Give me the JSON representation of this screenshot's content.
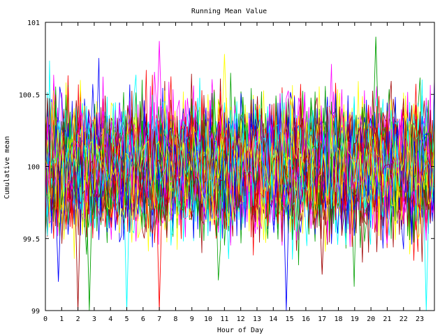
{
  "chart_data": {
    "type": "line",
    "title": "Running Mean Value",
    "xlabel": "Hour of Day",
    "ylabel": "Cumulative mean",
    "xlim": [
      0,
      23.9
    ],
    "ylim": [
      99,
      101
    ],
    "x_ticks": [
      "0",
      "1",
      "2",
      "3",
      "4",
      "5",
      "6",
      "7",
      "8",
      "9",
      "10",
      "11",
      "12",
      "13",
      "14",
      "15",
      "16",
      "17",
      "18",
      "19",
      "20",
      "21",
      "22",
      "23"
    ],
    "y_ticks": [
      "99",
      "99.5",
      "100",
      "100.5",
      "101"
    ],
    "grid": false,
    "legend": "none",
    "series_palette": [
      "#ff0000",
      "#00a000",
      "#0000ff",
      "#ff00ff",
      "#00ffff",
      "#a00000",
      "#ffff00"
    ],
    "series_count_description": "many overlapping random-walk series of running mean values fluctuating around 100",
    "notable_points": [
      {
        "x": 0.8,
        "y": 99.2
      },
      {
        "x": 2.0,
        "y": 99.0
      },
      {
        "x": 2.7,
        "y": 99.0
      },
      {
        "x": 5.0,
        "y": 99.0
      },
      {
        "x": 7.0,
        "y": 99.0
      },
      {
        "x": 7.0,
        "y": 100.87
      },
      {
        "x": 11.0,
        "y": 100.78
      },
      {
        "x": 14.8,
        "y": 99.0
      },
      {
        "x": 17.0,
        "y": 99.25
      },
      {
        "x": 20.3,
        "y": 100.9
      },
      {
        "x": 23.4,
        "y": 99.0
      }
    ],
    "center_value": 100,
    "typical_spread": 0.28
  }
}
